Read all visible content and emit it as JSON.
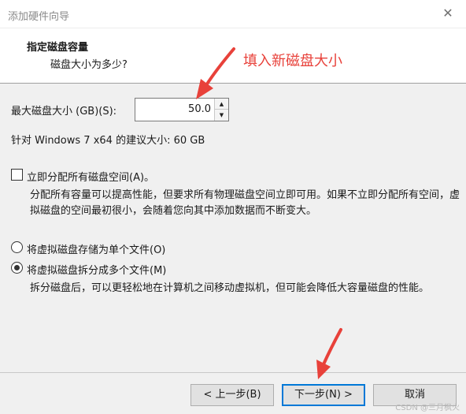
{
  "window": {
    "title": "添加硬件向导",
    "close_glyph": "✕"
  },
  "header": {
    "title": "指定磁盘容量",
    "subtitle": "磁盘大小为多少?"
  },
  "annotation": {
    "text": "填入新磁盘大小",
    "color": "#e8413a"
  },
  "disk_size": {
    "label": "最大磁盘大小 (GB)(S):",
    "value": "50.0",
    "up_glyph": "▲",
    "down_glyph": "▼"
  },
  "recommendation": "针对 Windows 7 x64 的建议大小: 60 GB",
  "allocate": {
    "label": "立即分配所有磁盘空间(A)。",
    "checked": false,
    "description": "分配所有容量可以提高性能，但要求所有物理磁盘空间立即可用。如果不立即分配所有空间，虚拟磁盘的空间最初很小，会随着您向其中添加数据而不断变大。"
  },
  "storage_options": [
    {
      "label": "将虚拟磁盘存储为单个文件(O)",
      "selected": false
    },
    {
      "label": "将虚拟磁盘拆分成多个文件(M)",
      "selected": true,
      "description": "拆分磁盘后，可以更轻松地在计算机之间移动虚拟机，但可能会降低大容量磁盘的性能。"
    }
  ],
  "buttons": {
    "back": "< 上一步(B)",
    "next": "下一步(N) >",
    "cancel": "取消"
  },
  "watermark": "CSDN @三月枫火"
}
